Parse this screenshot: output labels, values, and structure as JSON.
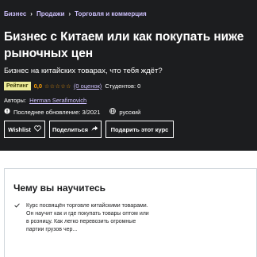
{
  "breadcrumb": {
    "items": [
      "Бизнес",
      "Продажи",
      "Торговля и коммерция"
    ],
    "separator": "›"
  },
  "course": {
    "title": "Бизнес с Китаем или как покупать ниже рыночных цен",
    "subtitle": "Бизнес на китайских товарах, что тебя ждёт?",
    "badge": "Рейтинг",
    "score": "0,0",
    "stars": "☆☆☆☆☆",
    "reviews": "(0 оценок)",
    "students": "Студентов: 0",
    "authors_label": "Авторы:",
    "author": "Herman Serafimovich",
    "last_updated": "Последнее обновление: 3/2021",
    "language": "русский"
  },
  "buttons": {
    "wishlist": "Wishlist",
    "share": "Поделиться",
    "gift": "Подарить этот курс"
  },
  "learn": {
    "heading": "Чему вы научитесь",
    "items": [
      "Курс посвящён торговле китайскими товарами. Он научит как и где покупать товары оптом или в розницу. Как легко перевозить огромные партии грузов чер..."
    ]
  },
  "colors": {
    "hero_bg": "#1c1d1f",
    "link": "#cec0fc",
    "star": "#f69c08",
    "badge_bg": "#eceb98"
  }
}
